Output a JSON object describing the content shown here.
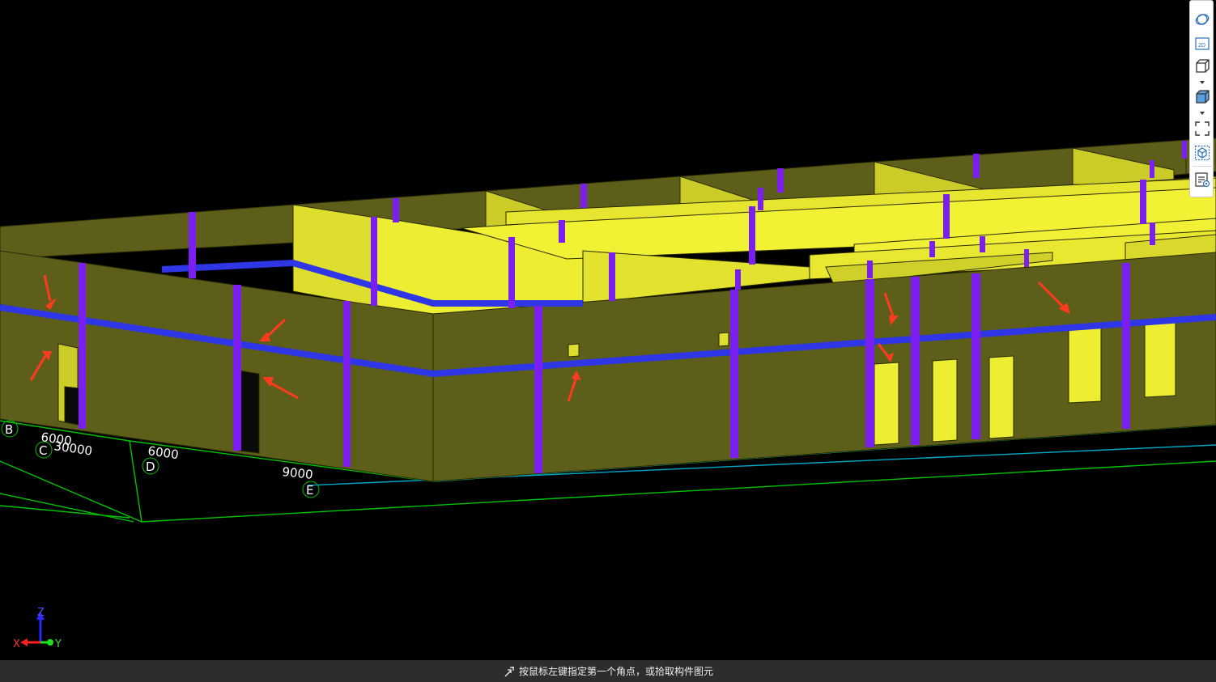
{
  "viewport": {
    "grid_axes": [
      {
        "id": "B",
        "label": "B"
      },
      {
        "id": "C",
        "label": "C"
      },
      {
        "id": "D",
        "label": "D"
      },
      {
        "id": "E",
        "label": "E"
      }
    ],
    "dimensions": [
      "6000",
      "30000",
      "6000",
      "9000"
    ],
    "axis_triad": {
      "x": "X",
      "y": "Y",
      "z": "Z"
    },
    "colors": {
      "wall_dark": "#5d5e1a",
      "wall_light": "#cccc29",
      "wall_bright": "#eded32",
      "column": "#7a1ff0",
      "ring_beam": "#2e36e6",
      "grid_line": "#00c400",
      "annotation_arrow": "#ff3b1f"
    }
  },
  "toolbar": {
    "items": [
      {
        "name": "orbit-icon",
        "title": "动态观察"
      },
      {
        "name": "view-2d-icon",
        "title": "2D",
        "text": "2D"
      },
      {
        "name": "view-3d-wire-icon",
        "title": "三维"
      },
      {
        "name": "view-3d-shaded-icon",
        "title": "着色"
      },
      {
        "name": "fullscreen-icon",
        "title": "全屏"
      },
      {
        "name": "cube-select-icon",
        "title": "局部三维"
      },
      {
        "name": "display-settings-icon",
        "title": "显示设置"
      }
    ]
  },
  "status": {
    "prompt": "按鼠标左键指定第一个角点，或拾取构件图元"
  }
}
